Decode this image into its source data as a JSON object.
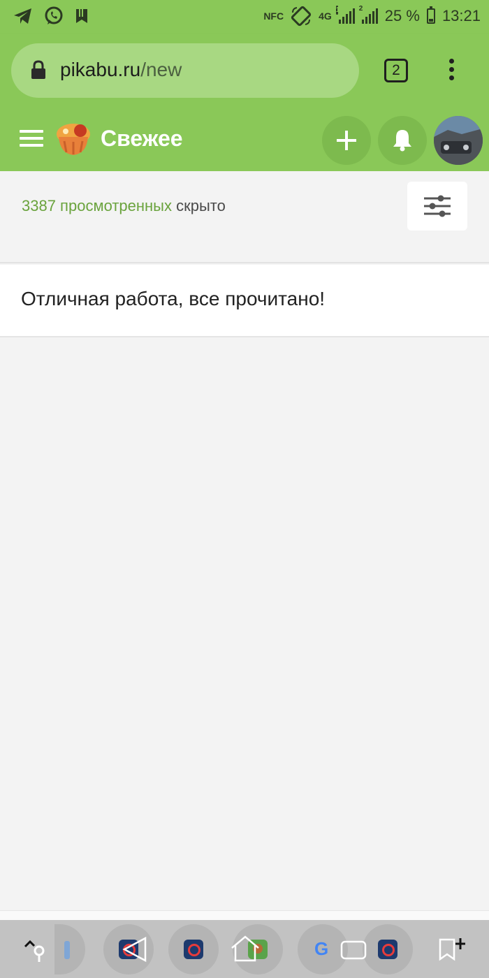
{
  "status_bar": {
    "nfc": "NFC",
    "network_type": "4G",
    "sim1_badge": "1",
    "sim2_badge": "2",
    "battery": "25 %",
    "time": "13:21",
    "left_icons": [
      "telegram-icon",
      "whatsapp-icon",
      "bookmark-notification-icon"
    ],
    "accent_color": "#8ac858"
  },
  "browser": {
    "url_domain": "pikabu.ru",
    "url_path": "/new",
    "tab_count": "2"
  },
  "header": {
    "title": "Свежее",
    "bg_color": "#8ac858"
  },
  "filter": {
    "viewed_count": "3387 просмотренных",
    "viewed_state": "скрыто",
    "link_color": "#6aa33d"
  },
  "message": {
    "text": "Отличная работа, все прочитано!"
  },
  "nav_bar": {
    "buttons": [
      "search-icon",
      "back-icon",
      "home-icon",
      "recents-icon",
      "bookmark-add-icon"
    ],
    "dock_apps": [
      "app-blue",
      "app-blue",
      "app-pikabu",
      "app-google",
      "app-blue"
    ]
  }
}
